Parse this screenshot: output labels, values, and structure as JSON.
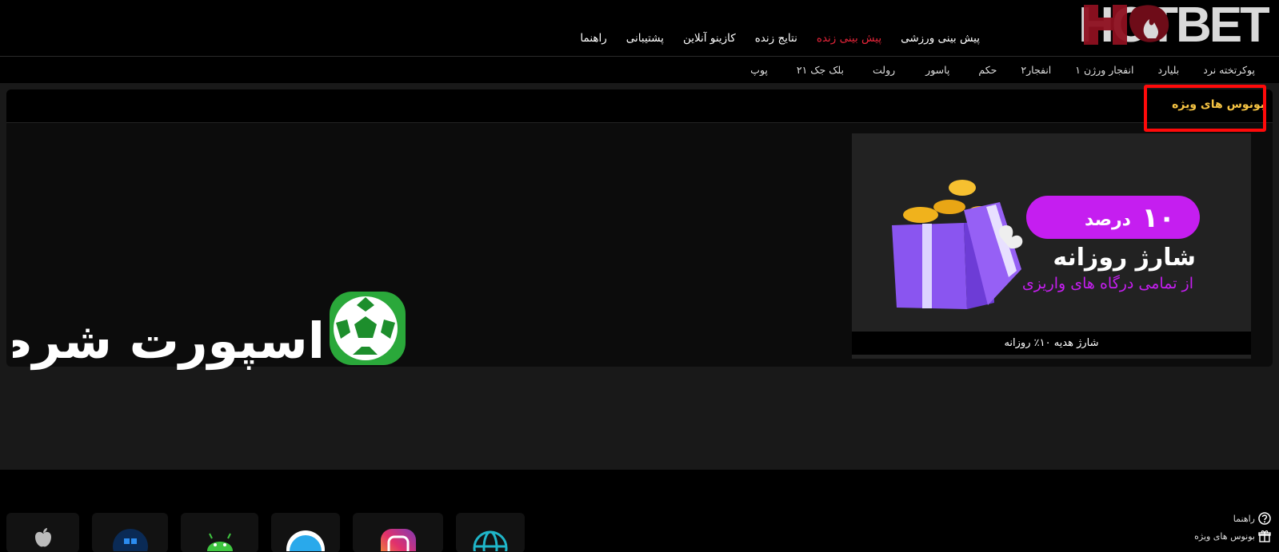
{
  "header": {
    "logo_text": "HOTBET",
    "nav": [
      {
        "label": "پیش بینی ورزشی",
        "active": false
      },
      {
        "label": "پیش بینی زنده",
        "active": true
      },
      {
        "label": "نتایج زنده",
        "active": false
      },
      {
        "label": "کازینو آنلاین",
        "active": false
      },
      {
        "label": "پشتیبانی",
        "active": false
      },
      {
        "label": "راهنما",
        "active": false
      }
    ]
  },
  "subnav": {
    "items": [
      "پوکر",
      "تخته نرد",
      "بلیارد",
      "انفجار ورژن ۱",
      "انفجار۲",
      "حکم",
      "پاسور",
      "رولت",
      "بلک جک ۲۱",
      "پوپ"
    ]
  },
  "section": {
    "title": "بونوس های ویژه"
  },
  "promo": {
    "badge_number": "۱۰",
    "badge_word": "درصد",
    "line1": "شارژ روزانه",
    "line2": "از تمامی درگاه های واریزی",
    "caption": "شارژ هدیه ۱۰٪ روزانه"
  },
  "sport_logo": {
    "text": "اسپورت شرط"
  },
  "footer": {
    "links": [
      {
        "label": "راهنما",
        "icon": "help-circle-icon"
      },
      {
        "label": "بونوس های ویژه",
        "icon": "gift-icon"
      }
    ],
    "apps": [
      "apple-icon",
      "windows-icon",
      "android-icon",
      "telegram-icon",
      "instagram-icon",
      "globe-icon"
    ]
  },
  "colors": {
    "accent_red": "#e8253a",
    "title_gold": "#f6c443",
    "promo_purple": "#c51ef0",
    "highlight_box": "#ff0a0a"
  }
}
